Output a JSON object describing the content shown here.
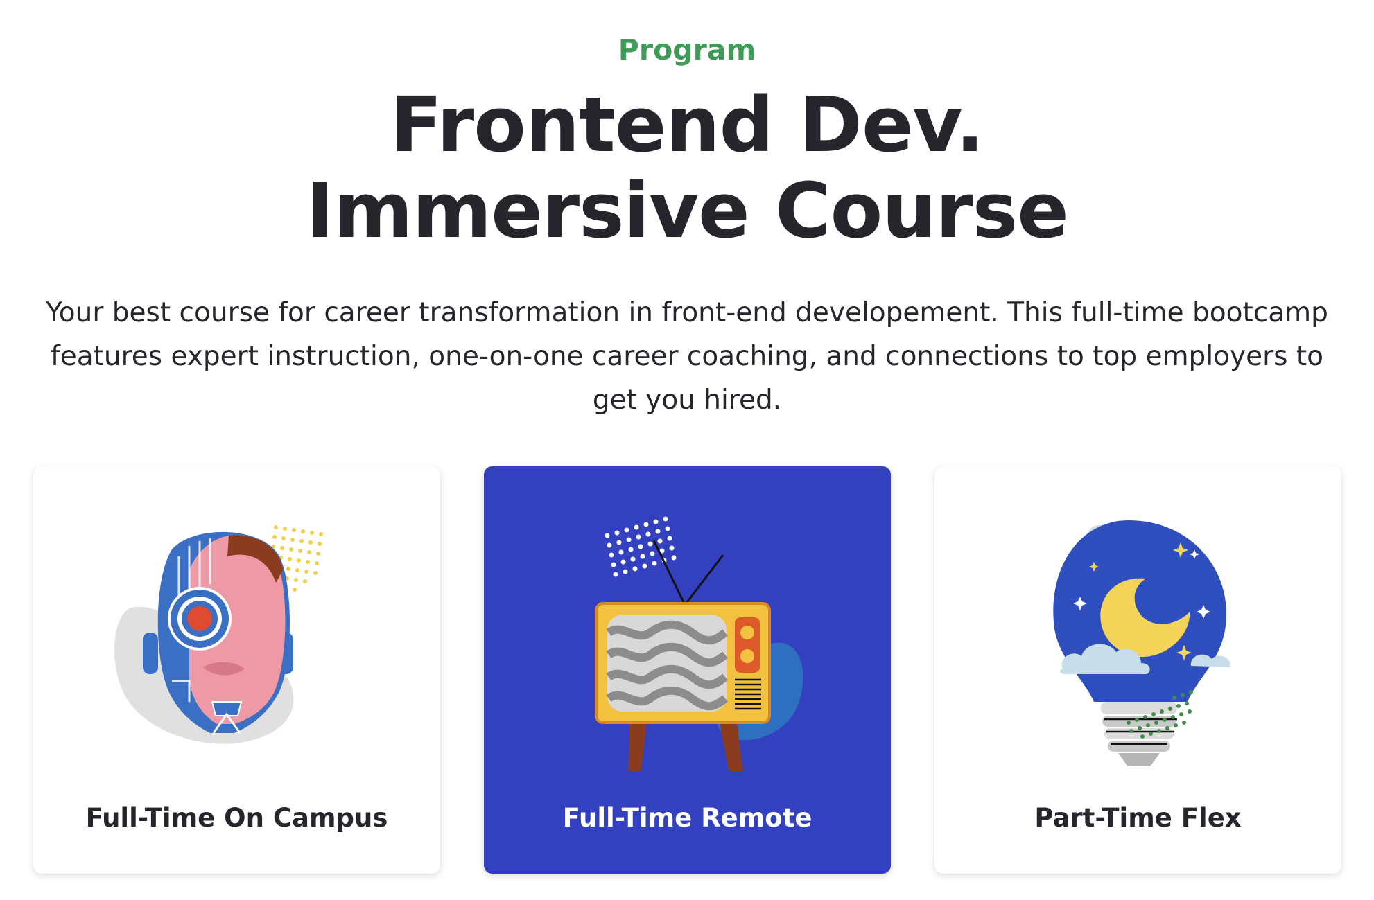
{
  "header": {
    "eyebrow": "Program",
    "title_line1": "Frontend Dev.",
    "title_line2": "Immersive Course",
    "description": "Your best course for career transformation in front-end developement. This full-time bootcamp features expert instruction, one-on-one career coaching, and connections to top employers to get you hired."
  },
  "colors": {
    "accent_green": "#3f9b58",
    "selected_card_bg": "#3340bf",
    "text_dark": "#25252b"
  },
  "cards": [
    {
      "label": "Full-Time On Campus",
      "icon": "robot-face-icon",
      "selected": false
    },
    {
      "label": "Full-Time Remote",
      "icon": "retro-tv-icon",
      "selected": true
    },
    {
      "label": "Part-Time Flex",
      "icon": "night-lightbulb-icon",
      "selected": false
    }
  ]
}
